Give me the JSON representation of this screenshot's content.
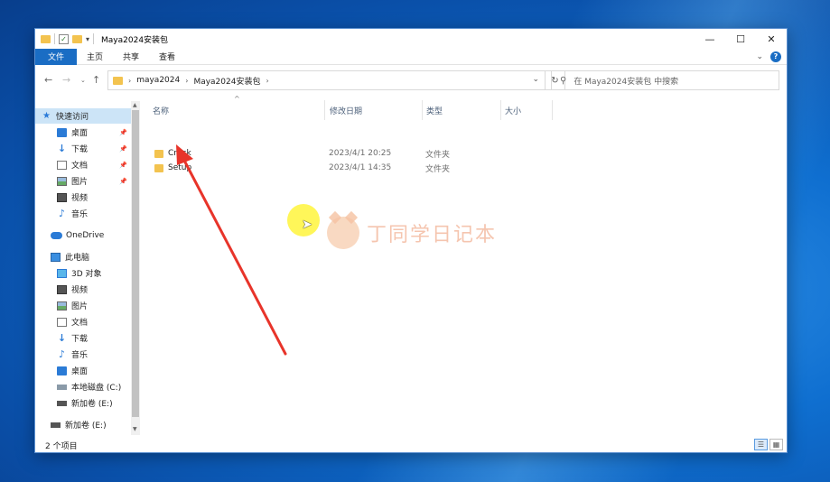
{
  "window": {
    "title": "Maya2024安装包",
    "controls": {
      "minimize": "—",
      "maximize": "☐",
      "close": "✕"
    }
  },
  "ribbon": {
    "tabs": [
      "文件",
      "主页",
      "共享",
      "查看"
    ],
    "help": "?"
  },
  "address": {
    "crumbs": [
      "maya2024",
      "Maya2024安装包"
    ],
    "search_placeholder": "在 Maya2024安装包 中搜索"
  },
  "nav": {
    "quick_access": "快速访问",
    "quick_items": [
      "桌面",
      "下载",
      "文档",
      "图片",
      "视频",
      "音乐"
    ],
    "onedrive": "OneDrive",
    "this_pc": "此电脑",
    "pc_items": [
      "3D 对象",
      "视频",
      "图片",
      "文档",
      "下载",
      "音乐",
      "桌面",
      "本地磁盘 (C:)",
      "新加卷 (E:)"
    ],
    "extra_drive": "新加卷 (E:)"
  },
  "columns": {
    "name": "名称",
    "date": "修改日期",
    "type": "类型",
    "size": "大小"
  },
  "files": [
    {
      "name": "Crack",
      "date": "2023/4/1 20:25",
      "type": "文件夹"
    },
    {
      "name": "Setup",
      "date": "2023/4/1 14:35",
      "type": "文件夹"
    }
  ],
  "status": {
    "count": "2 个项目"
  },
  "watermark": {
    "text": "丁同学日记本"
  },
  "colors": {
    "accent": "#1a6dc4",
    "annotation_arrow": "#e8342a",
    "cursor_highlight": "#fff53c"
  }
}
